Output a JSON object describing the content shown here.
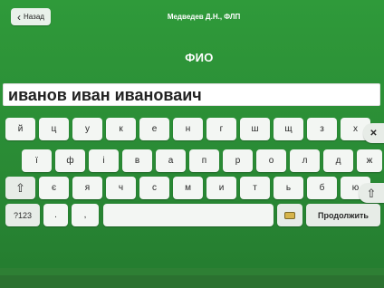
{
  "header": {
    "back_label": "Назад",
    "title": "Медведев Д.Н., ФЛП",
    "field_title": "ФИО"
  },
  "input": {
    "value": "иванов иван ивановаич"
  },
  "keyboard": {
    "row1": [
      "й",
      "ц",
      "у",
      "к",
      "е",
      "н",
      "г",
      "ш",
      "щ",
      "з",
      "х"
    ],
    "row2": [
      "ї",
      "ф",
      "і",
      "в",
      "а",
      "п",
      "р",
      "о",
      "л",
      "д",
      "ж"
    ],
    "row3": [
      "є",
      "я",
      "ч",
      "с",
      "м",
      "и",
      "т",
      "ь",
      "б",
      "ю"
    ],
    "mode_label": "?123",
    "dot_label": ".",
    "comma_label": ",",
    "continue_label": "Продолжить"
  },
  "footer": {
    "texts": [
      "",
      "",
      "",
      "",
      ""
    ]
  }
}
